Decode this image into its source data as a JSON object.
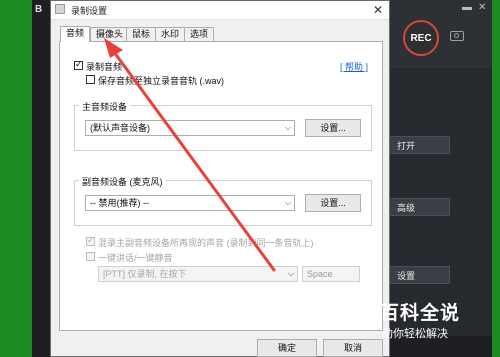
{
  "app": {
    "title_fragment": "B",
    "rec_label": "REC",
    "side_buttons": [
      "打开",
      "高级",
      "设置"
    ]
  },
  "dialog": {
    "title": "录制设置",
    "close_glyph": "✕",
    "tabs": [
      {
        "label": "音频",
        "active": true
      },
      {
        "label": "摄像头",
        "active": false
      },
      {
        "label": "鼠标",
        "active": false
      },
      {
        "label": "水印",
        "active": false
      },
      {
        "label": "选项",
        "active": false
      }
    ],
    "record_audio": {
      "label": "录制音频",
      "checked": true
    },
    "save_separate": {
      "label": "保存音频至独立录音音轨 (.wav)",
      "checked": false
    },
    "help_link": "[ 帮助 ]",
    "main_device": {
      "group_title": "主音频设备",
      "selected": "(默认声音设备)",
      "settings_label": "设置..."
    },
    "secondary_device": {
      "group_title": "副音频设备 (麦克风)",
      "selected": "-- 禁用(推荐) --",
      "settings_label": "设置..."
    },
    "mix_option": {
      "label": "混录主副音频设备所再现的声音 (录制到同一条音轨上)",
      "checked": true,
      "disabled": true
    },
    "ptt_option": {
      "label": "一键讲话/一键静音",
      "checked": false,
      "disabled": true
    },
    "ptt_select": "[PTT] 仅录制, 在按下",
    "hotkey": "Space",
    "ok_label": "确定",
    "cancel_label": "取消"
  },
  "watermark": {
    "title": "百科全说",
    "subtitle": "助你轻松解决"
  },
  "colors": {
    "annotation_arrow": "#e8413a",
    "rec_ring": "#d8473d",
    "background_green": "#1b8a22"
  }
}
